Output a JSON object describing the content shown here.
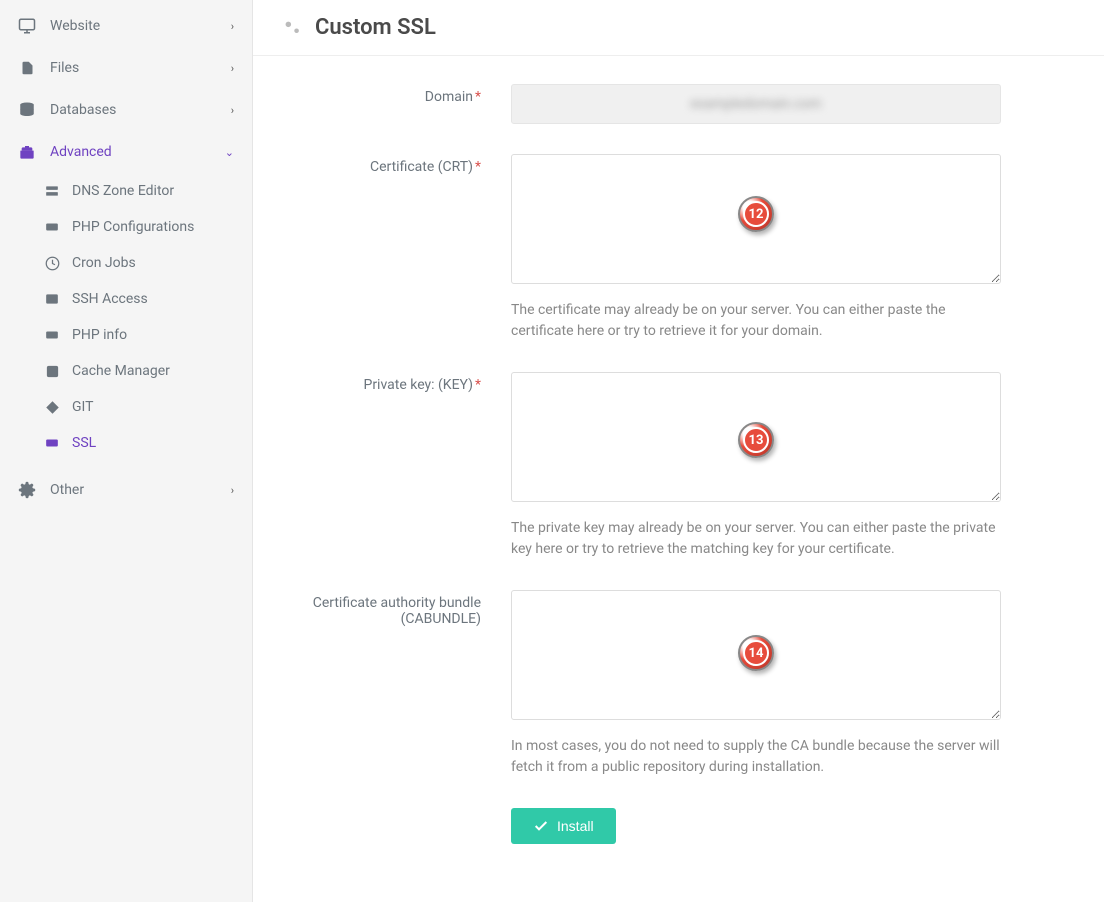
{
  "sidebar": {
    "items": [
      {
        "label": "Website",
        "icon": "monitor"
      },
      {
        "label": "Files",
        "icon": "file"
      },
      {
        "label": "Databases",
        "icon": "database"
      },
      {
        "label": "Advanced",
        "icon": "toolbox",
        "expanded": true
      },
      {
        "label": "Other",
        "icon": "cogs"
      }
    ],
    "advanced_sub": [
      {
        "label": "DNS Zone Editor",
        "icon": "dns"
      },
      {
        "label": "PHP Configurations",
        "icon": "php"
      },
      {
        "label": "Cron Jobs",
        "icon": "clock"
      },
      {
        "label": "SSH Access",
        "icon": "terminal"
      },
      {
        "label": "PHP info",
        "icon": "info"
      },
      {
        "label": "Cache Manager",
        "icon": "cache"
      },
      {
        "label": "GIT",
        "icon": "git"
      },
      {
        "label": "SSL",
        "icon": "ssl",
        "active": true
      }
    ]
  },
  "page": {
    "title": "Custom SSL"
  },
  "form": {
    "domain": {
      "label": "Domain",
      "value": "exampledomain.com"
    },
    "certificate": {
      "label": "Certificate (CRT)",
      "value": "",
      "help": "The certificate may already be on your server. You can either paste the certificate here or try to retrieve it for your domain."
    },
    "private_key": {
      "label": "Private key: (KEY)",
      "value": "",
      "help": "The private key may already be on your server. You can either paste the private key here or try to retrieve the matching key for your certificate."
    },
    "ca_bundle": {
      "label": "Certificate authority bundle (CABUNDLE)",
      "value": "",
      "help": "In most cases, you do not need to supply the CA bundle because the server will fetch it from a public repository during installation."
    },
    "install_label": "Install"
  },
  "markers": {
    "m12": "12",
    "m13": "13",
    "m14": "14"
  }
}
